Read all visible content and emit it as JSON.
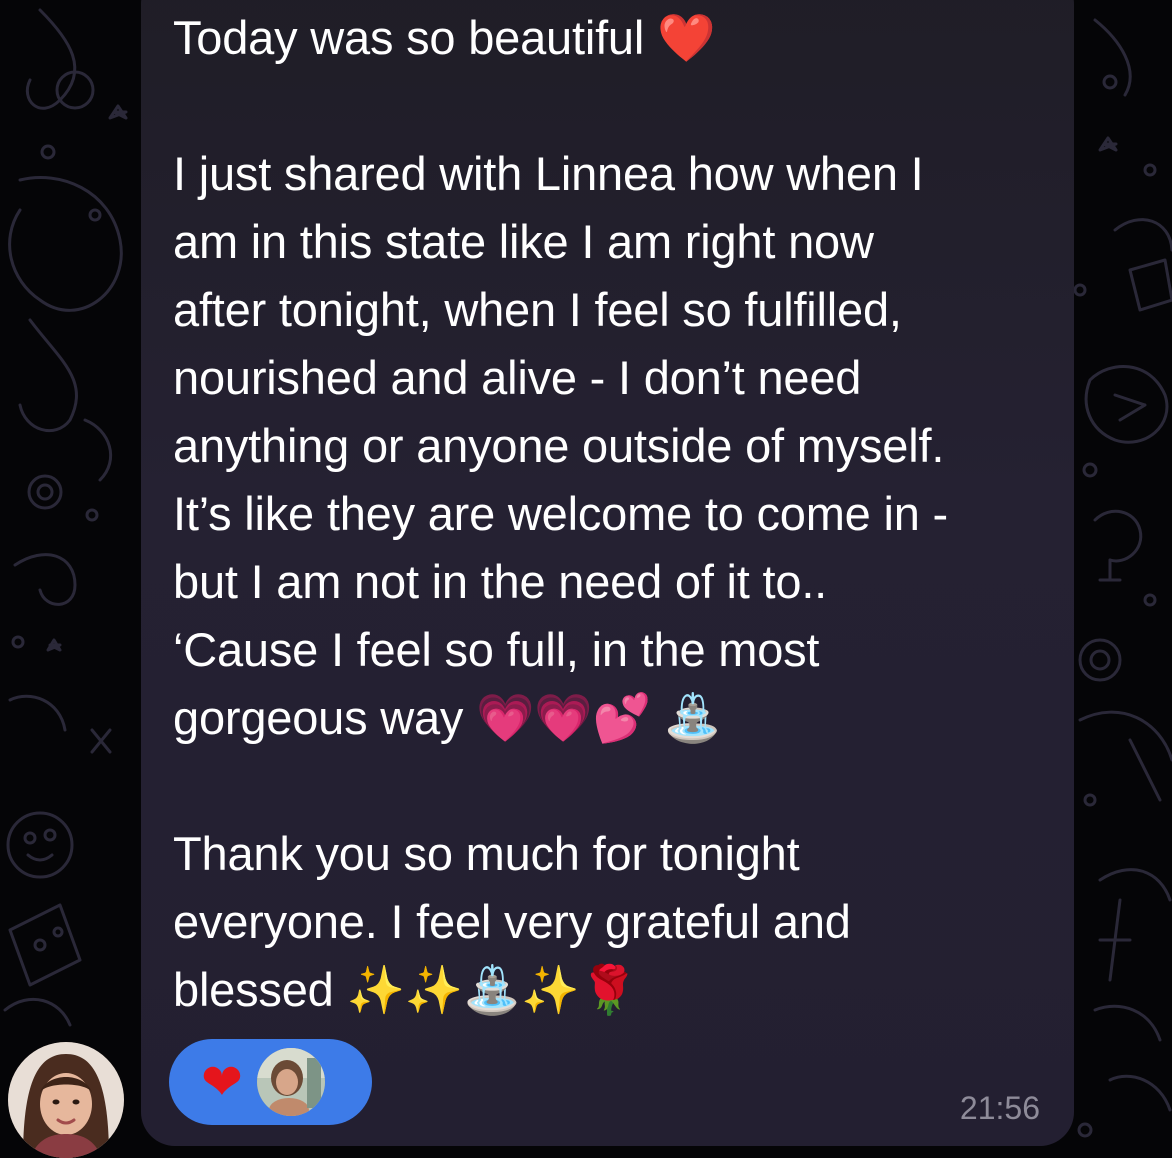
{
  "message": {
    "text": "Today was so beautiful ❤️\n\nI just shared with Linnea how when I\nam in this state like I am right now\nafter tonight, when I feel so fulfilled,\nnourished and alive - I don’t need\nanything or anyone outside of myself.\nIt’s like they are welcome to come in -\nbut I am not in the need of it to..\n‘Cause I feel so full, in the most\ngorgeous way 💗💗💕 ⛲\n\nThank you so much for tonight\neveryone. I feel very grateful and\nblessed ✨✨⛲✨🌹",
    "time": "21:56"
  },
  "reaction": {
    "emoji": "❤",
    "reactor_avatar_icon": "reactor-avatar-icon"
  },
  "sender": {
    "avatar_icon": "sender-avatar-icon"
  },
  "colors": {
    "background": "#050507",
    "bubble": "#231f2f",
    "reaction_pill": "#3d7be8",
    "timestamp": "#8e8b99",
    "text": "#ffffff"
  }
}
